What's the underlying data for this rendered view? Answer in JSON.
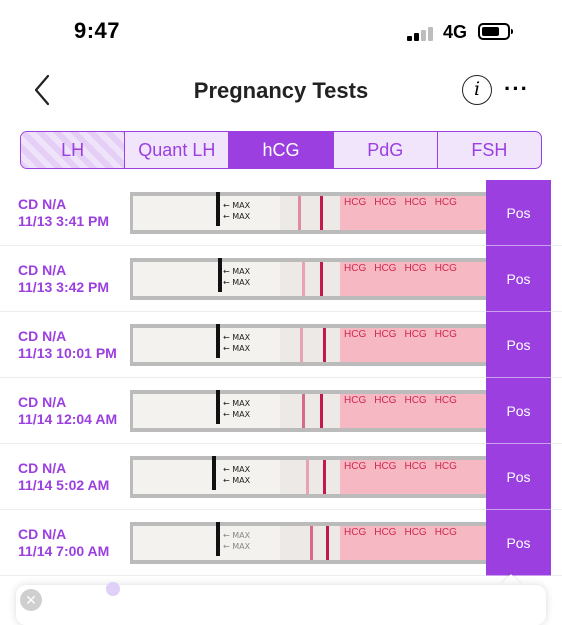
{
  "status_bar": {
    "time": "9:47",
    "network": "4G"
  },
  "nav": {
    "title": "Pregnancy Tests",
    "info_glyph": "i",
    "more_glyph": "···"
  },
  "tabs": [
    {
      "label": "LH",
      "active": false
    },
    {
      "label": "Quant LH",
      "active": false
    },
    {
      "label": "hCG",
      "active": true
    },
    {
      "label": "PdG",
      "active": false
    },
    {
      "label": "FSH",
      "active": false
    }
  ],
  "strip_labels": {
    "max": "← MAX",
    "brand": "HCG"
  },
  "rows": [
    {
      "cd": "CD N/A",
      "datetime": "11/13 3:41 PM",
      "result": "Pos"
    },
    {
      "cd": "CD N/A",
      "datetime": "11/13 3:42 PM",
      "result": "Pos"
    },
    {
      "cd": "CD N/A",
      "datetime": "11/13 10:01 PM",
      "result": "Pos"
    },
    {
      "cd": "CD N/A",
      "datetime": "11/14 12:04 AM",
      "result": "Pos"
    },
    {
      "cd": "CD N/A",
      "datetime": "11/14 5:02 AM",
      "result": "Pos"
    },
    {
      "cd": "CD N/A",
      "datetime": "11/14 7:00 AM",
      "result": "Pos"
    }
  ],
  "popup": {
    "close_glyph": "✕"
  },
  "colors": {
    "accent": "#9b3fe0",
    "tab_bg": "#f1e5fb",
    "line": "#c2184a",
    "pink": "#f6b8c3"
  },
  "icons": [
    "back-chevron-icon",
    "info-icon",
    "more-icon",
    "signal-icon",
    "battery-icon",
    "close-icon"
  ]
}
